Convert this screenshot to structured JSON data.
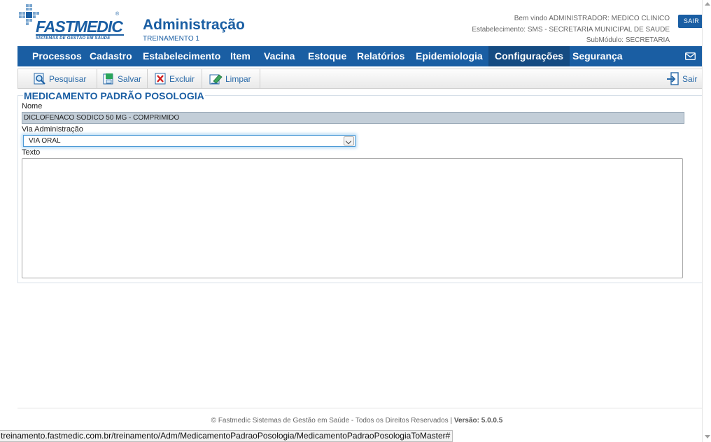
{
  "header": {
    "logo_text": "FASTMEDIC",
    "logo_tagline": "SISTEMAS DE GESTÃO EM SAÚDE",
    "title": "Administração",
    "subtitle": "TREINAMENTO 1",
    "welcome": "Bem vindo ADMINISTRADOR: MEDICO CLINICO",
    "establishment": "Estabelecimento: SMS - SECRETARIA MUNICIPAL DE SAUDE",
    "submodule": "SubMódulo: SECRETARIA",
    "logout_label": "SAIR"
  },
  "nav": {
    "items": [
      {
        "label": "Processos"
      },
      {
        "label": "Cadastro"
      },
      {
        "label": "Estabelecimento"
      },
      {
        "label": "Item"
      },
      {
        "label": "Vacina"
      },
      {
        "label": "Estoque"
      },
      {
        "label": "Relatórios"
      },
      {
        "label": "Epidemiologia"
      },
      {
        "label": "Configurações"
      },
      {
        "label": "Segurança"
      }
    ],
    "active": "Configurações",
    "mail_icon": "envelope-icon"
  },
  "toolbar": {
    "search_label": "Pesquisar",
    "save_label": "Salvar",
    "delete_label": "Excluir",
    "clear_label": "Limpar",
    "exit_label": "Sair"
  },
  "form": {
    "title": "MEDICAMENTO PADRÃO POSOLOGIA",
    "name_label": "Nome",
    "name_value": "DICLOFENACO SODICO 50 MG - COMPRIMIDO",
    "route_label": "Via Administração",
    "route_value": "VIA ORAL",
    "text_label": "Texto",
    "text_value": ""
  },
  "footer": {
    "copyright": "© Fastmedic Sistemas de Gestão em Saúde - Todos os Direitos Reservados |",
    "version": "Versão: 5.0.0.5"
  },
  "statusbar": {
    "url": "treinamento.fastmedic.com.br/treinamento/Adm/MedicamentoPadraoPosologia/MedicamentoPadraoPosologiaToMaster#"
  },
  "colors": {
    "brand": "#1a5ea3",
    "nav_active": "#154b82"
  }
}
